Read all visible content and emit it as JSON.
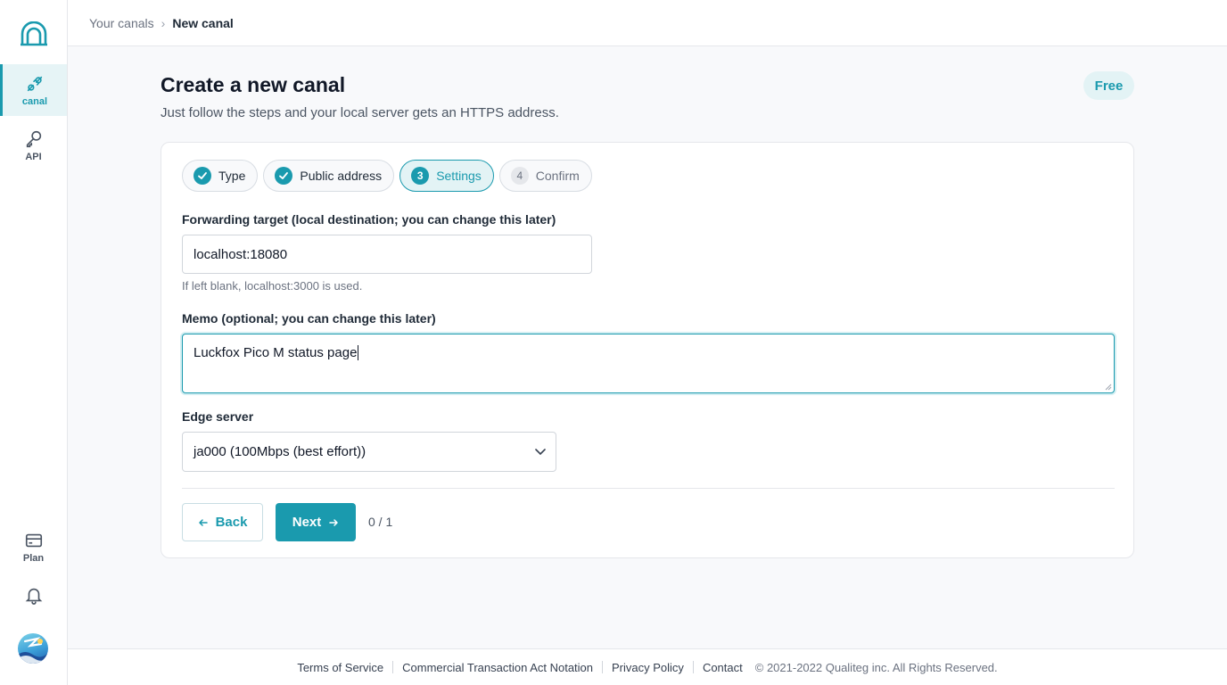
{
  "sidebar": {
    "logo_icon": "tunnel-arch-icon",
    "items": [
      {
        "label": "canal",
        "icon": "link-plug-icon",
        "active": true
      },
      {
        "label": "API",
        "icon": "key-icon",
        "active": false
      },
      {
        "label": "Plan",
        "icon": "credit-card-icon",
        "active": false
      }
    ],
    "notifications_icon": "bell-icon",
    "avatar_icon": "user-avatar-icon"
  },
  "breadcrumb": {
    "parent": "Your canals",
    "current": "New canal"
  },
  "page": {
    "title": "Create a new canal",
    "subtitle": "Just follow the steps and your local server gets an HTTPS address.",
    "plan_badge": "Free"
  },
  "steps": [
    {
      "number": "1",
      "label": "Type",
      "status": "done"
    },
    {
      "number": "2",
      "label": "Public address",
      "status": "done"
    },
    {
      "number": "3",
      "label": "Settings",
      "status": "current"
    },
    {
      "number": "4",
      "label": "Confirm",
      "status": "pending"
    }
  ],
  "form": {
    "forwarding_label": "Forwarding target (local destination; you can change this later)",
    "forwarding_value": "localhost:18080",
    "forwarding_help": "If left blank, localhost:3000 is used.",
    "memo_label": "Memo (optional; you can change this later)",
    "memo_value": "Luckfox Pico M status page",
    "edge_label": "Edge server",
    "edge_value": "ja000 (100Mbps (best effort))"
  },
  "actions": {
    "back_label": "Back",
    "next_label": "Next",
    "progress": "0 / 1"
  },
  "footer": {
    "links": [
      "Terms of Service",
      "Commercial Transaction Act Notation",
      "Privacy Policy",
      "Contact"
    ],
    "copyright": "© 2021-2022 Qualiteg inc. All Rights Reserved."
  },
  "colors": {
    "accent": "#1a9aae",
    "accent_light": "#e3f3f5",
    "background": "#f8f9fb"
  }
}
